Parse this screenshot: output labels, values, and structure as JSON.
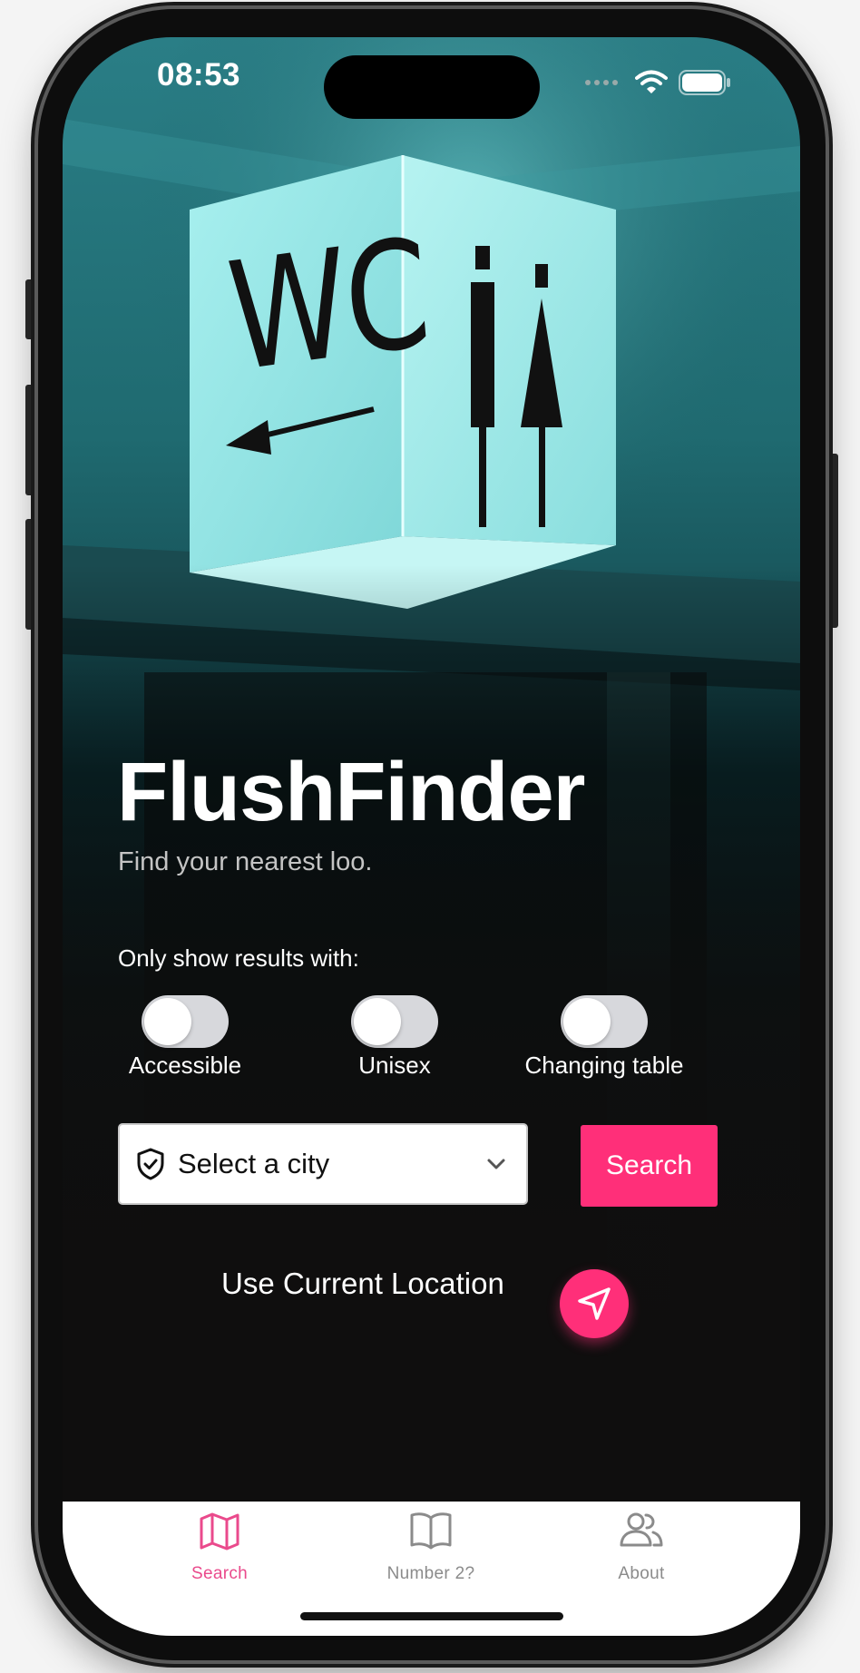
{
  "status_bar": {
    "time": "08:53"
  },
  "app": {
    "title": "FlushFinder",
    "subtitle": "Find your nearest loo."
  },
  "sign": {
    "text": "WC"
  },
  "filters": {
    "heading": "Only show results with:",
    "toggles": [
      {
        "label": "Accessible",
        "on": false
      },
      {
        "label": "Unisex",
        "on": false
      },
      {
        "label": "Changing table",
        "on": false
      }
    ]
  },
  "city_select": {
    "placeholder": "Select a city",
    "icon": "shield-check-icon"
  },
  "search_button": {
    "label": "Search"
  },
  "location": {
    "label": "Use Current Location",
    "icon": "navigation-arrow-icon"
  },
  "tabs": [
    {
      "label": "Search",
      "icon": "map-icon",
      "active": true
    },
    {
      "label": "Number 2?",
      "icon": "book-icon",
      "active": false
    },
    {
      "label": "About",
      "icon": "users-icon",
      "active": false
    }
  ],
  "colors": {
    "accent": "#ff2f79",
    "active_tab": "#ea4a8c",
    "inactive_tab": "#8b8b8b",
    "sign_glow": "#8fe3e3",
    "toggle_off": "#d7d8dc"
  }
}
